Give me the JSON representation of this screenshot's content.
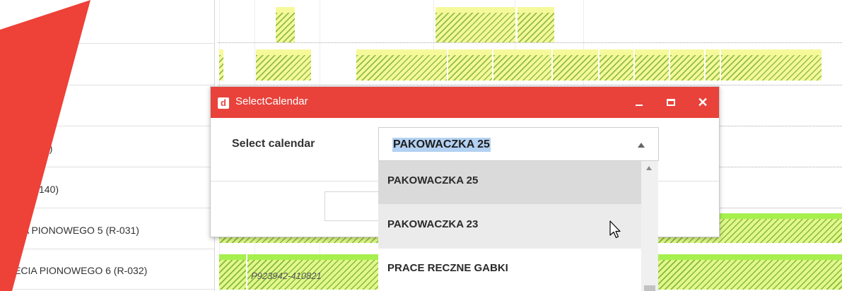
{
  "gantt": {
    "row_labels": [
      "0)",
      "140)",
      "CIA PIONOWEGO 5 (R-031)",
      "ECIA PIONOWEGO 6 (R-032)"
    ],
    "bar_labels": [
      "P923942-410821"
    ]
  },
  "dialog": {
    "icon": "d",
    "title": "SelectCalendar",
    "field_label": "Select calendar",
    "selected_value": "PAKOWACZKA 25",
    "titlebar_color": "#e8423b",
    "buttons": {
      "minimize_icon": "minimize-icon",
      "maximize_icon": "maximize-icon",
      "close_icon": "close-icon",
      "close_glyph": "✕"
    }
  },
  "dropdown": {
    "options": [
      "PAKOWACZKA 25",
      "PAKOWACZKA 23",
      "PRACE RECZNE GABKI"
    ],
    "highlighted_index": 0,
    "hover_index": 1
  },
  "colors": {
    "accent_red": "#e8423b",
    "bar_yellow": "#f4f89a",
    "bar_green": "#a6f04e",
    "selection_blue": "#b3d1f2"
  }
}
